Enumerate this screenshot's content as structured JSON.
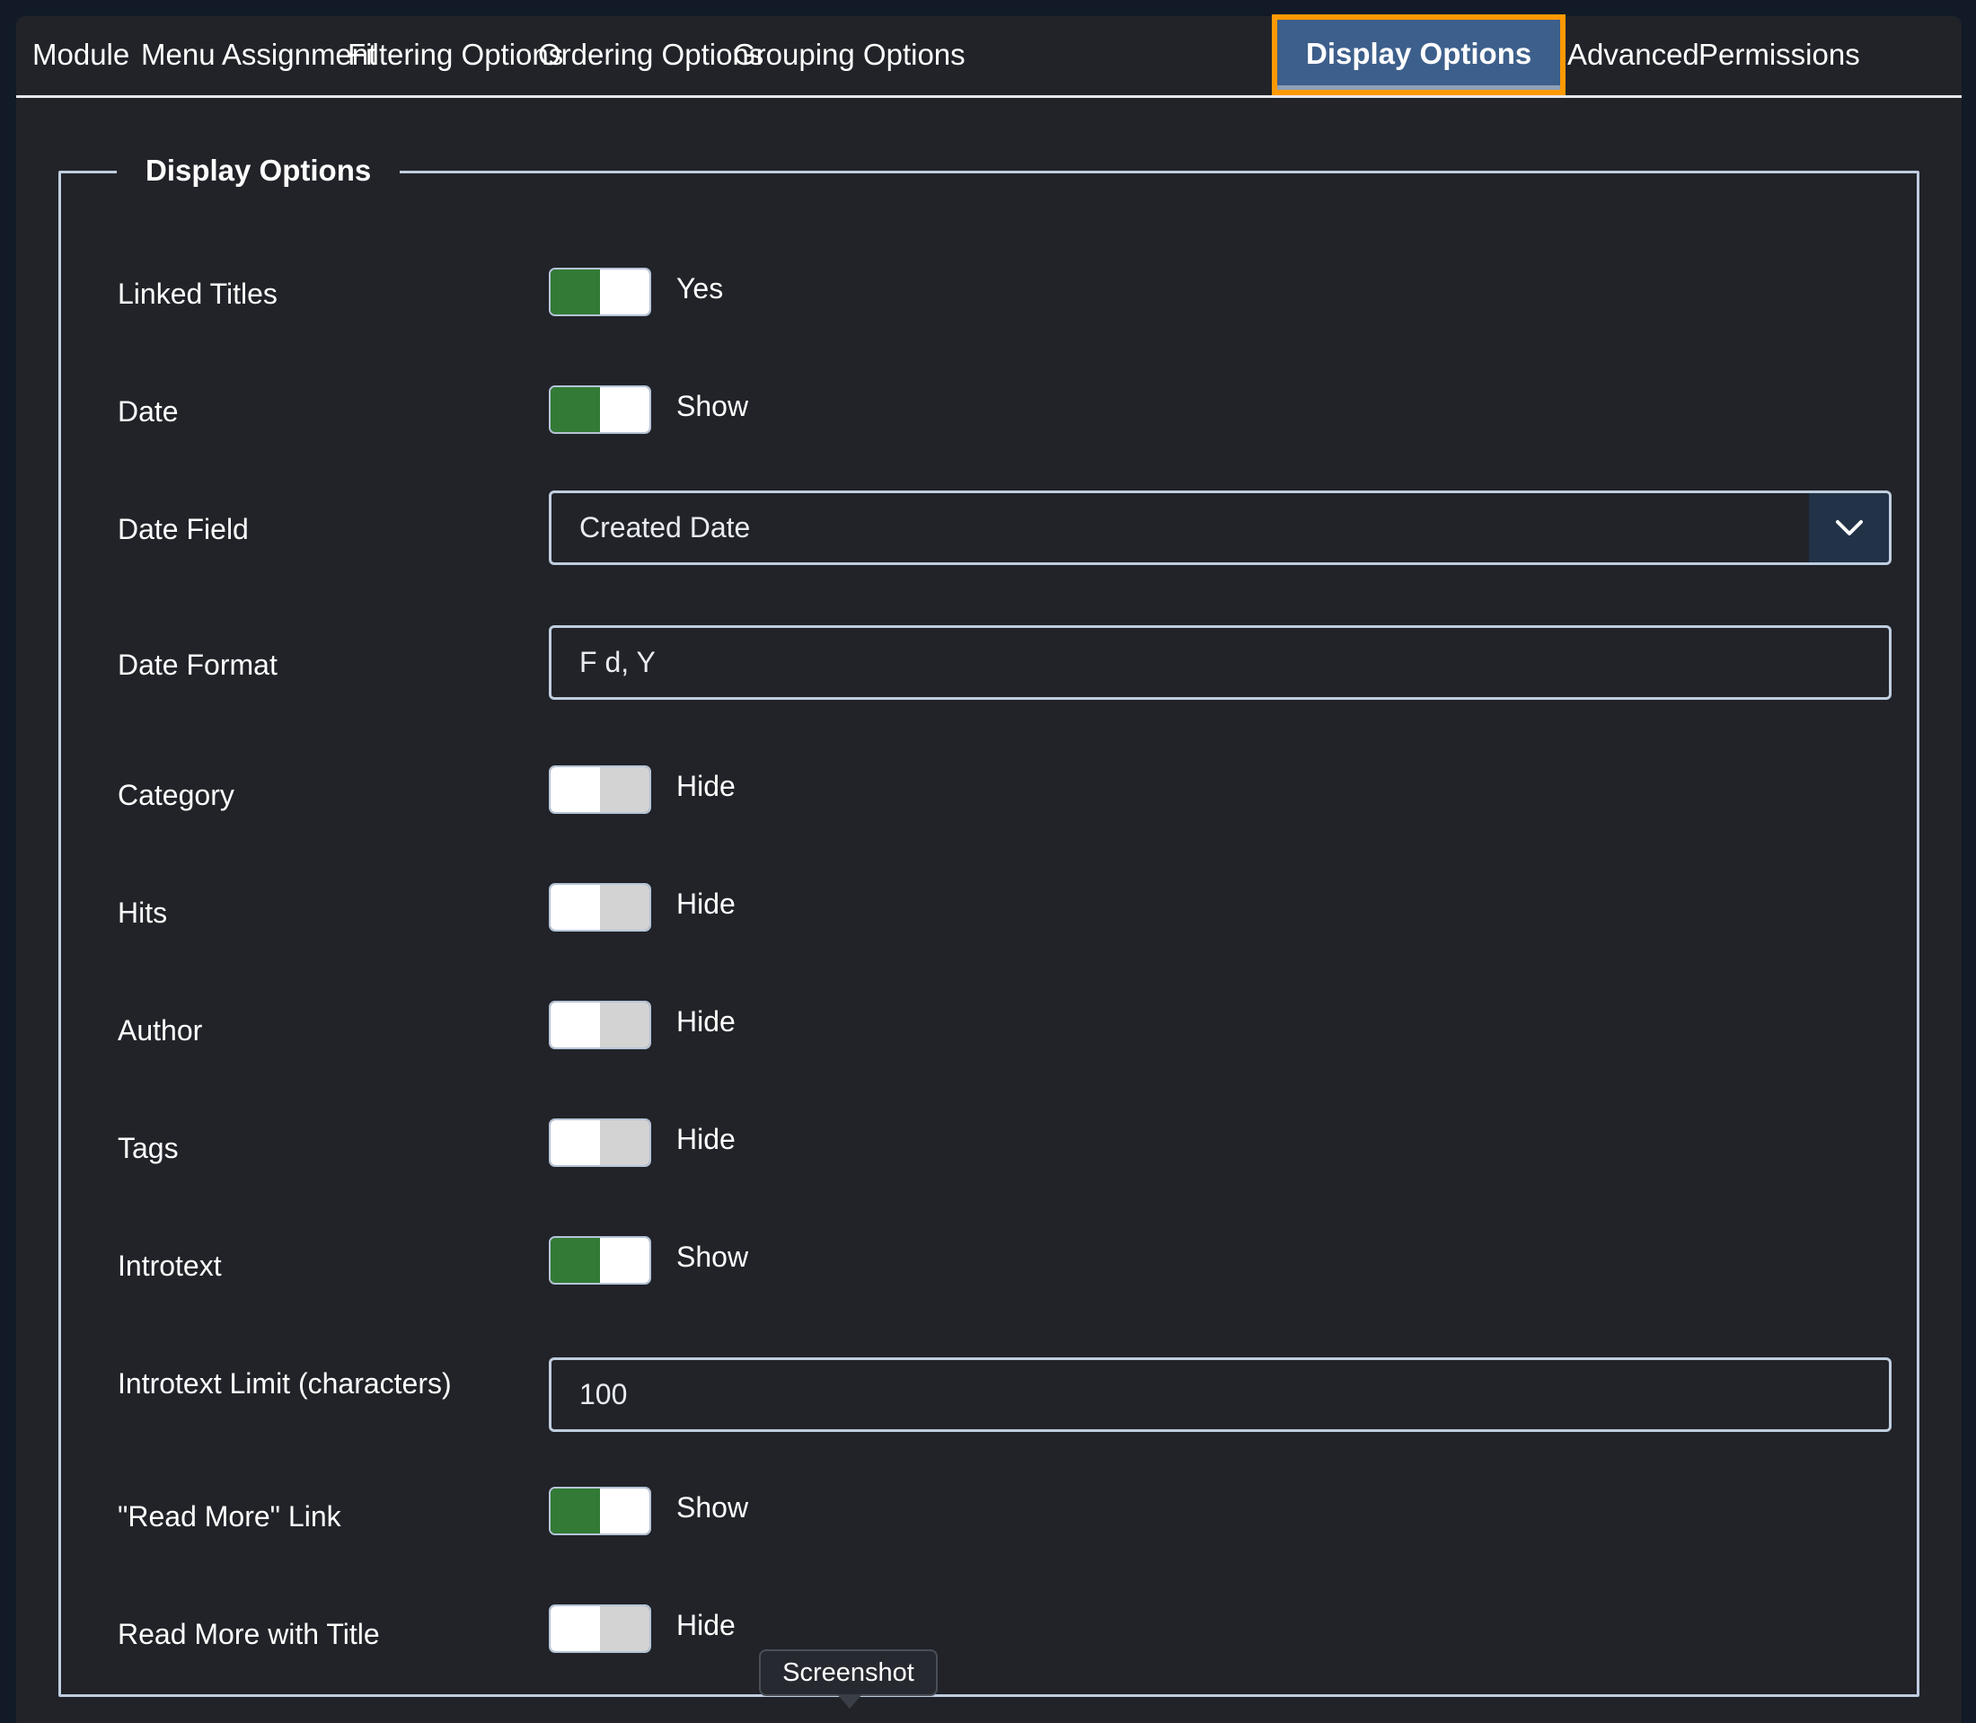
{
  "tabs": [
    {
      "label": "Module",
      "active": false
    },
    {
      "label": "Menu Assignment",
      "active": false
    },
    {
      "label": "Filtering Options",
      "active": false
    },
    {
      "label": "Ordering Options",
      "active": false
    },
    {
      "label": "Grouping Options",
      "active": false
    },
    {
      "label": "Display Options",
      "active": true
    },
    {
      "label": "Advanced",
      "active": false
    },
    {
      "label": "Permissions",
      "active": false
    }
  ],
  "fieldset": {
    "legend": "Display Options",
    "fields": {
      "linked_titles": {
        "label": "Linked Titles",
        "state": "on",
        "value_text": "Yes"
      },
      "date": {
        "label": "Date",
        "state": "on",
        "value_text": "Show"
      },
      "date_field": {
        "label": "Date Field",
        "selected": "Created Date"
      },
      "date_format": {
        "label": "Date Format",
        "value": "F d, Y"
      },
      "category": {
        "label": "Category",
        "state": "off",
        "value_text": "Hide"
      },
      "hits": {
        "label": "Hits",
        "state": "off",
        "value_text": "Hide"
      },
      "author": {
        "label": "Author",
        "state": "off",
        "value_text": "Hide"
      },
      "tags": {
        "label": "Tags",
        "state": "off",
        "value_text": "Hide"
      },
      "introtext": {
        "label": "Introtext",
        "state": "on",
        "value_text": "Show"
      },
      "introtext_limit": {
        "label": "Introtext Limit (characters)",
        "value": "100"
      },
      "read_more_link": {
        "label": "\"Read More\" Link",
        "state": "on",
        "value_text": "Show"
      },
      "read_more_with_title": {
        "label": "Read More with Title",
        "state": "off",
        "value_text": "Hide"
      }
    }
  },
  "tooltip": {
    "text": "Screenshot"
  },
  "colors": {
    "page_bg": "#111a26",
    "panel_bg": "#212328",
    "active_tab_bg": "#3d5f8b",
    "highlight_outline": "#ff9900",
    "toggle_on": "#327a35",
    "toggle_off": "#d3d3d3",
    "border": "#bfcde0"
  }
}
